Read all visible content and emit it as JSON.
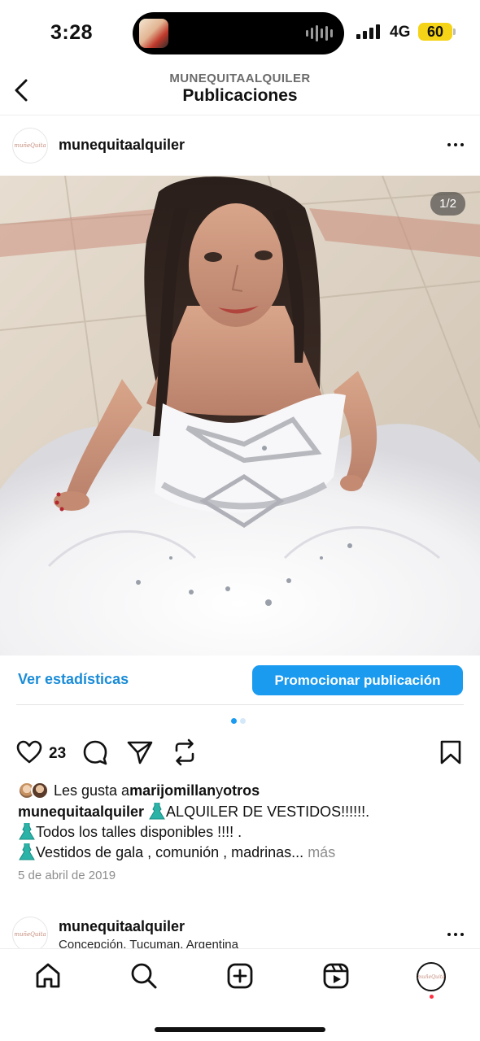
{
  "status_bar": {
    "time": "3:28",
    "network": "4G",
    "battery": "60",
    "battery_color": "#f5d316"
  },
  "header": {
    "subtitle": "MUNEQUITAALQUILER",
    "title": "Publicaciones",
    "back_icon": "chevron-left-icon"
  },
  "post": {
    "avatar_text": "muñeQuita",
    "username": "munequitaalquiler",
    "more_icon": "ellipsis-icon",
    "image_counter": "1/2",
    "image_description_icon": "photo",
    "stats_link": "Ver estadísticas",
    "promote_button": "Promocionar publicación",
    "carousel": {
      "total": 2,
      "active": 1
    },
    "likes_count": "23",
    "liked_by": {
      "prefix": "Les gusta a ",
      "user": "marijomillan",
      "connector": " y ",
      "others": "otros"
    },
    "caption": {
      "author": "munequitaalquiler",
      "line1": "ALQUILER DE VESTIDOS!!!!!!.",
      "line2": "Todos los talles disponibles !!!! .",
      "line3": "Vestidos de gala , comunión , madrinas...",
      "more": " más"
    },
    "date": "5 de abril de 2019"
  },
  "next_post": {
    "avatar_text": "muñeQuita",
    "username": "munequitaalquiler",
    "location": "Concepción, Tucuman, Argentina"
  },
  "tab_bar": {
    "items": [
      "home-icon",
      "search-icon",
      "create-icon",
      "reels-icon",
      "profile-icon"
    ],
    "profile_avatar_text": "muñeQuita"
  },
  "colors": {
    "accent": "#1a9bf0",
    "link": "#1a8cd8",
    "muted": "#8e8e8e"
  }
}
